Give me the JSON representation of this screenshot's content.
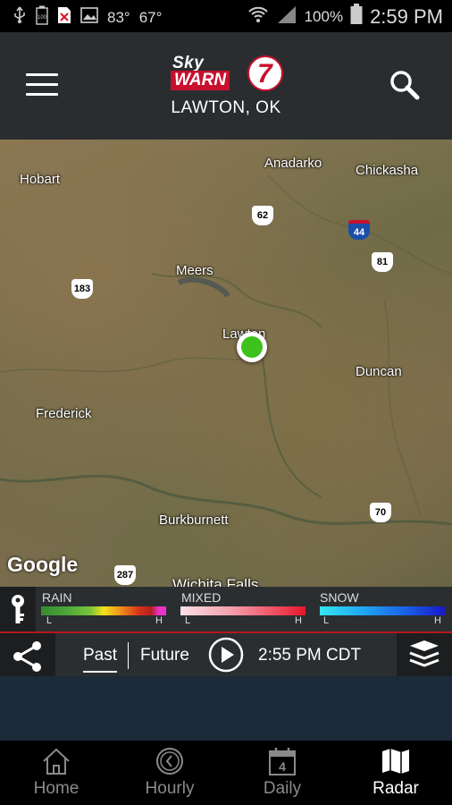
{
  "status_bar": {
    "temp_hi": "83°",
    "temp_lo": "67°",
    "battery": "100%",
    "time": "2:59 PM"
  },
  "header": {
    "logo_sky": "Sky",
    "logo_warn": "WARN",
    "logo_number": "7",
    "location": "LAWTON, OK",
    "menu_icon": "hamburger-menu-icon",
    "search_icon": "search-icon"
  },
  "map": {
    "places": {
      "hobart": "Hobart",
      "anadarko": "Anadarko",
      "chickasha": "Chickasha",
      "meers": "Meers",
      "lawton": "Lawton",
      "duncan": "Duncan",
      "frederick": "Frederick",
      "burkburnett": "Burkburnett",
      "wichita_falls": "Wichita Falls"
    },
    "shields": {
      "r62": "62",
      "r44": "44",
      "r81": "81",
      "r183": "183",
      "r70": "70",
      "r287": "287"
    },
    "attribution": "Google",
    "location_dot_color": "#3cc21a"
  },
  "legend": {
    "key_icon": "key-icon",
    "rain": {
      "label": "RAIN",
      "low": "L",
      "high": "H"
    },
    "mixed": {
      "label": "MIXED",
      "low": "L",
      "high": "H"
    },
    "snow": {
      "label": "SNOW",
      "low": "L",
      "high": "H"
    }
  },
  "controls": {
    "share_icon": "share-icon",
    "past": "Past",
    "future": "Future",
    "play_icon": "play-icon",
    "current_time": "2:55 PM CDT",
    "layers_icon": "layers-icon",
    "accent_color": "#b3181d"
  },
  "bottom_nav": {
    "items": [
      {
        "label": "Home",
        "icon": "home-icon"
      },
      {
        "label": "Hourly",
        "icon": "clock-icon"
      },
      {
        "label": "Daily",
        "icon": "calendar-icon",
        "badge": "4"
      },
      {
        "label": "Radar",
        "icon": "map-icon",
        "active": true
      }
    ]
  }
}
